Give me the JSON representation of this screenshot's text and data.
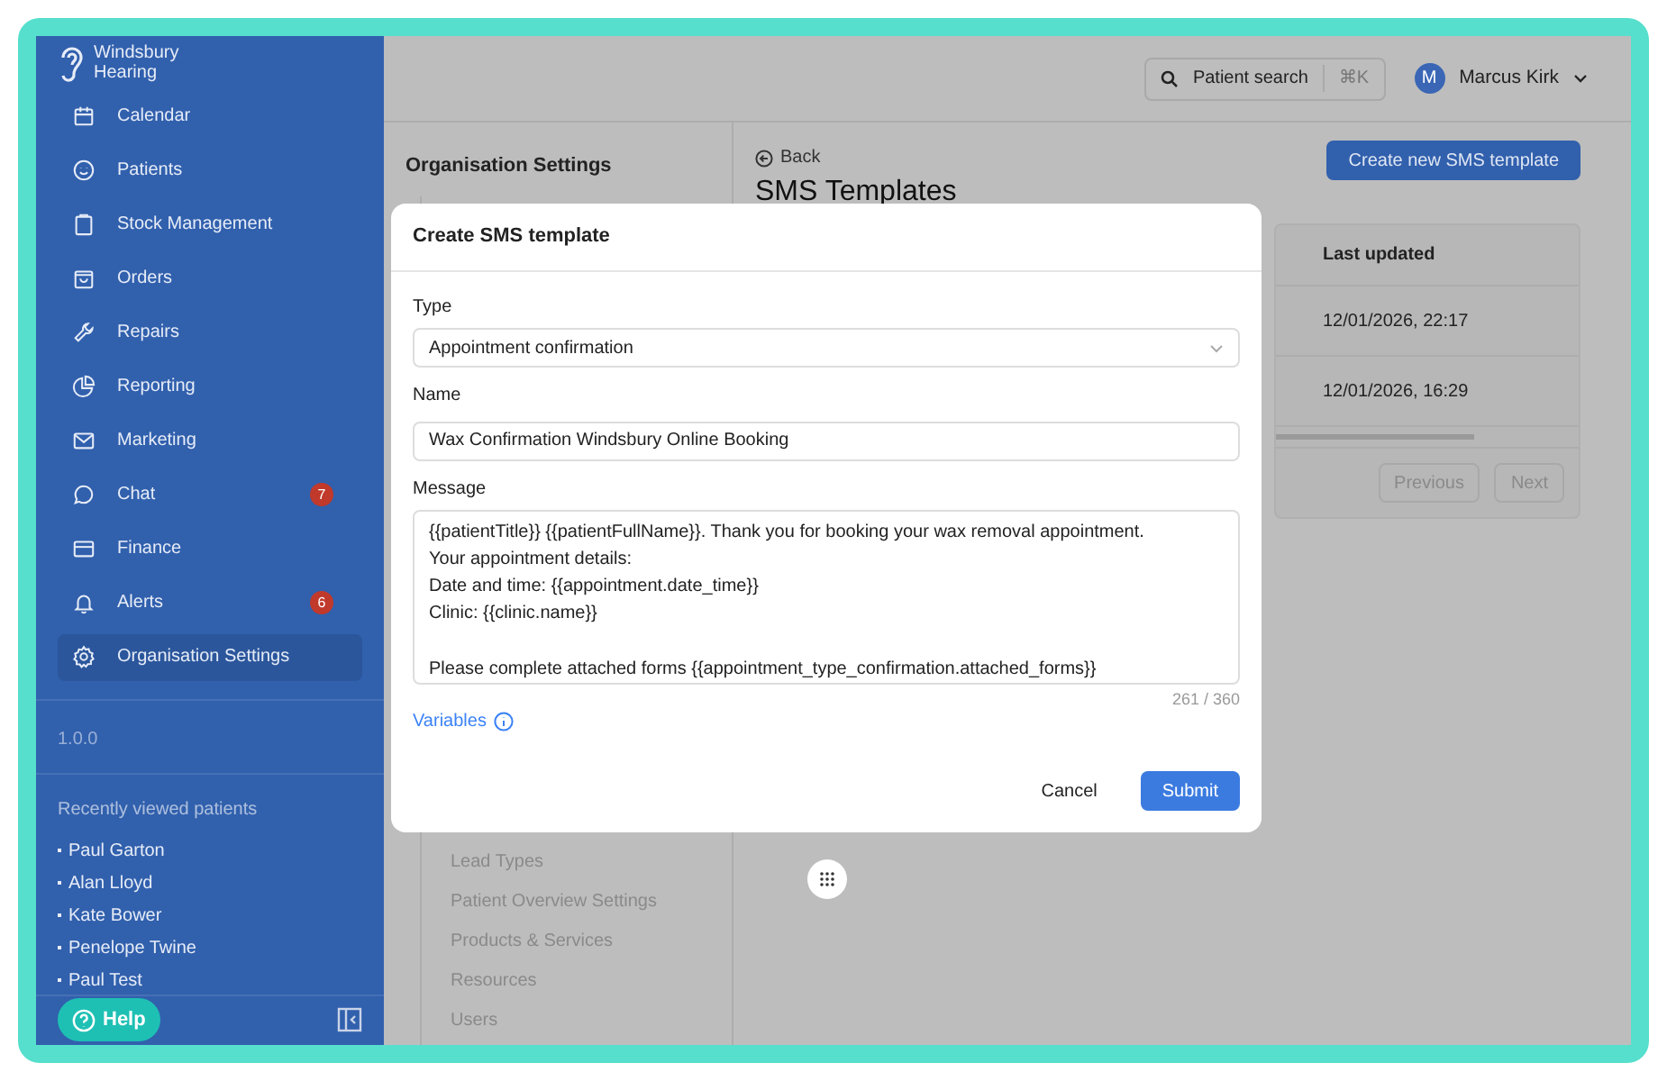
{
  "brand": {
    "line1": "Windsbury",
    "line2": "Hearing"
  },
  "nav": [
    {
      "label": "Calendar",
      "selected": false
    },
    {
      "label": "Patients",
      "selected": false
    },
    {
      "label": "Stock Management",
      "selected": false
    },
    {
      "label": "Orders",
      "selected": false
    },
    {
      "label": "Repairs",
      "selected": false
    },
    {
      "label": "Reporting",
      "selected": false
    },
    {
      "label": "Marketing",
      "selected": false
    },
    {
      "label": "Chat",
      "selected": false,
      "badge": "7"
    },
    {
      "label": "Finance",
      "selected": false
    },
    {
      "label": "Alerts",
      "selected": false,
      "badge": "6"
    },
    {
      "label": "Organisation Settings",
      "selected": true
    }
  ],
  "version": "1.0.0",
  "recent": {
    "title": "Recently viewed patients",
    "patients": [
      "Paul Garton",
      "Alan Lloyd",
      "Kate Bower",
      "Penelope Twine",
      "Paul Test"
    ]
  },
  "help": "Help",
  "search": {
    "label": "Patient search",
    "shortcut": "⌘K"
  },
  "user": {
    "initial": "M",
    "name": "Marcus Kirk"
  },
  "settings": {
    "title": "Organisation Settings",
    "items": [
      "Lead Types",
      "Patient Overview Settings",
      "Products & Services",
      "Resources",
      "Users"
    ]
  },
  "page": {
    "back": "Back",
    "title": "SMS Templates",
    "create": "Create new SMS template",
    "table": {
      "columns": [
        "Last updated"
      ],
      "rows": [
        [
          "12/01/2026, 22:17"
        ],
        [
          "12/01/2026, 16:29"
        ]
      ]
    },
    "pagination": [
      "Previous",
      "Next"
    ]
  },
  "modal": {
    "title": "Create SMS template",
    "fields": [
      {
        "kind": "select",
        "label": "Type",
        "value": "Appointment confirmation"
      },
      {
        "kind": "text",
        "label": "Name",
        "value": "Wax Confirmation Windsbury Online Booking"
      },
      {
        "kind": "textarea",
        "label": "Message",
        "value": "{{patientTitle}} {{patientFullName}}. Thank you for booking your wax removal appointment.\nYour appointment details:\nDate and time: {{appointment.date_time}}\nClinic: {{clinic.name}}\n\nPlease complete attached forms {{appointment_type_confirmation.attached_forms}}",
        "counter": "261 / 360"
      }
    ],
    "variables": "Variables",
    "cancel": "Cancel",
    "submit": "Submit"
  }
}
